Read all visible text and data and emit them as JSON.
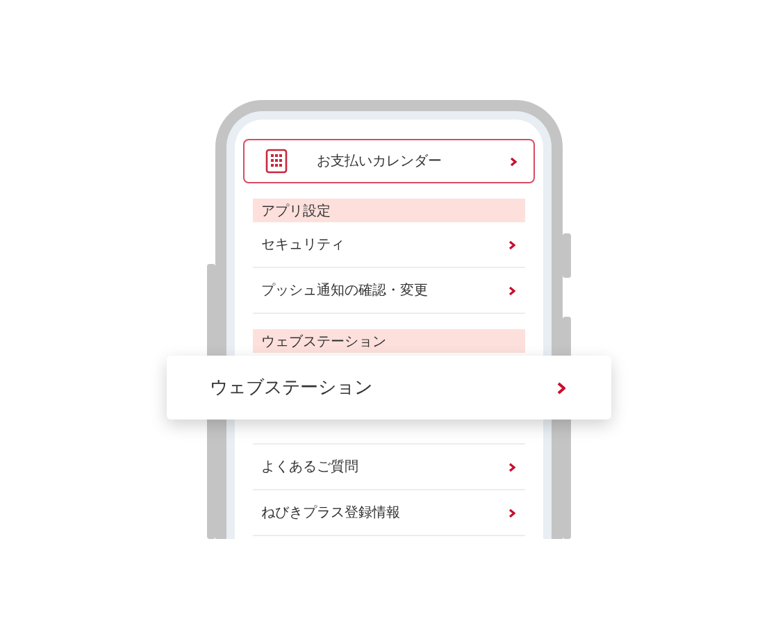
{
  "calendar_button": {
    "label": "お支払いカレンダー"
  },
  "sections": [
    {
      "header": "アプリ設定",
      "items": [
        {
          "label": "セキュリティ"
        },
        {
          "label": "プッシュ通知の確認・変更"
        }
      ]
    },
    {
      "header": "ウェブステーション",
      "items": [
        {
          "kind": "hidden"
        },
        {
          "kind": "hidden"
        },
        {
          "label": "よくあるご質問"
        },
        {
          "label": "ねびきプラス登録情報"
        }
      ]
    }
  ],
  "highlight_card": {
    "label": "ウェブステーション"
  }
}
